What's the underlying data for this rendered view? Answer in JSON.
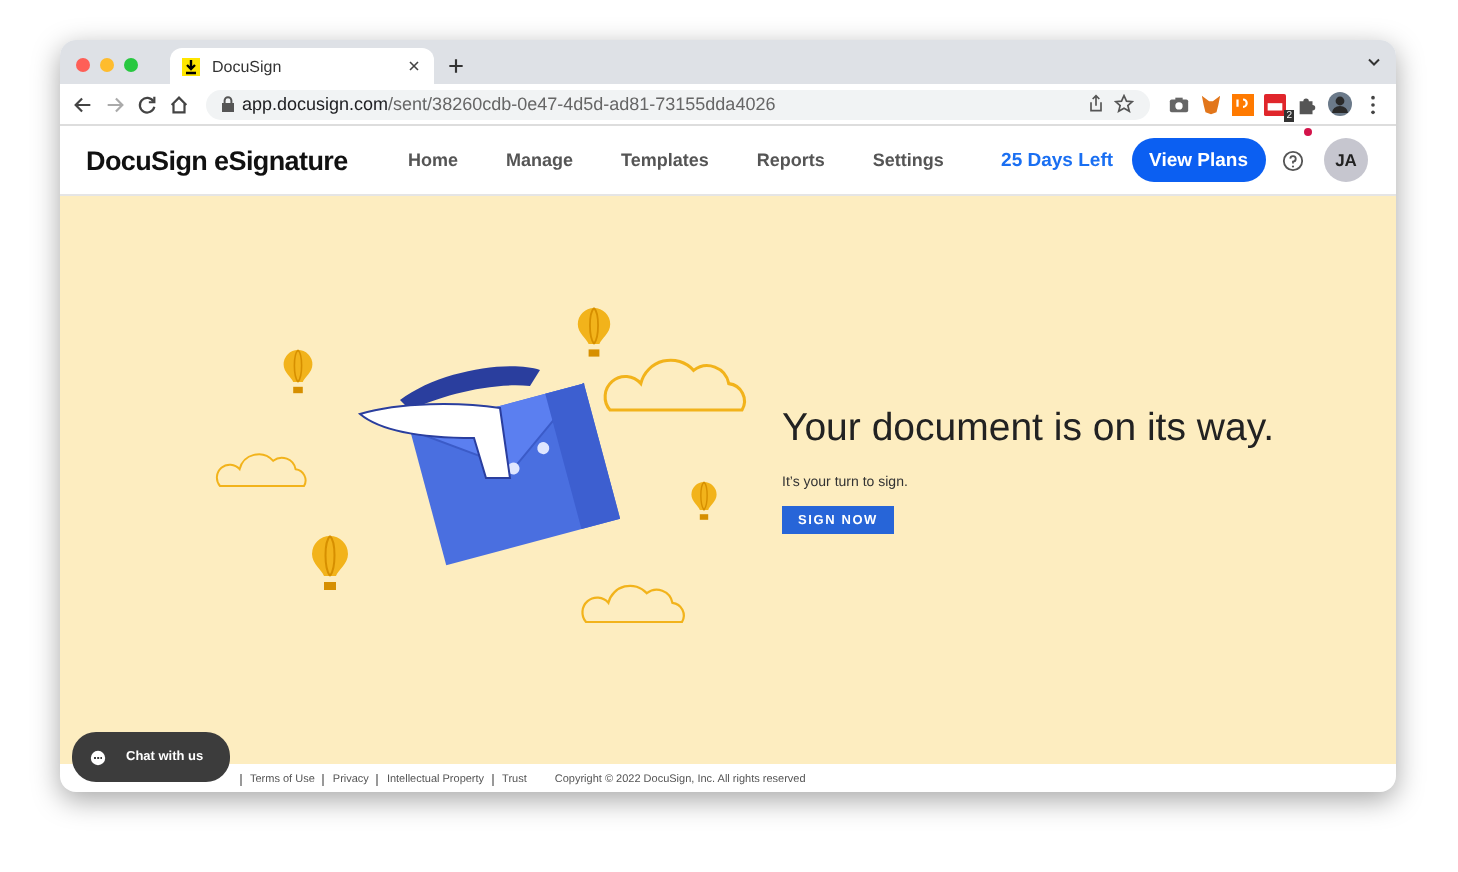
{
  "browser": {
    "tab_title": "DocuSign",
    "url_host": "app.docusign.com",
    "url_path": "/sent/38260cdb-0e47-4d5d-ad81-73155dda4026",
    "extension_badge": "2"
  },
  "header": {
    "logo": "DocuSign eSignature",
    "nav": [
      {
        "label": "Home"
      },
      {
        "label": "Manage"
      },
      {
        "label": "Templates"
      },
      {
        "label": "Reports"
      },
      {
        "label": "Settings"
      }
    ],
    "trial": "25 Days Left",
    "cta": "View Plans",
    "avatar": "JA",
    "notification_dot": true
  },
  "hero": {
    "title": "Your document is on its way.",
    "subtitle": "It’s your turn to sign.",
    "button": "SIGN NOW"
  },
  "chat": {
    "label": "Chat with us"
  },
  "footer": {
    "links": [
      "Terms of Use",
      "Privacy",
      "Intellectual Property",
      "Trust"
    ],
    "copyright": "Copyright © 2022 DocuSign, Inc. All rights reserved"
  }
}
